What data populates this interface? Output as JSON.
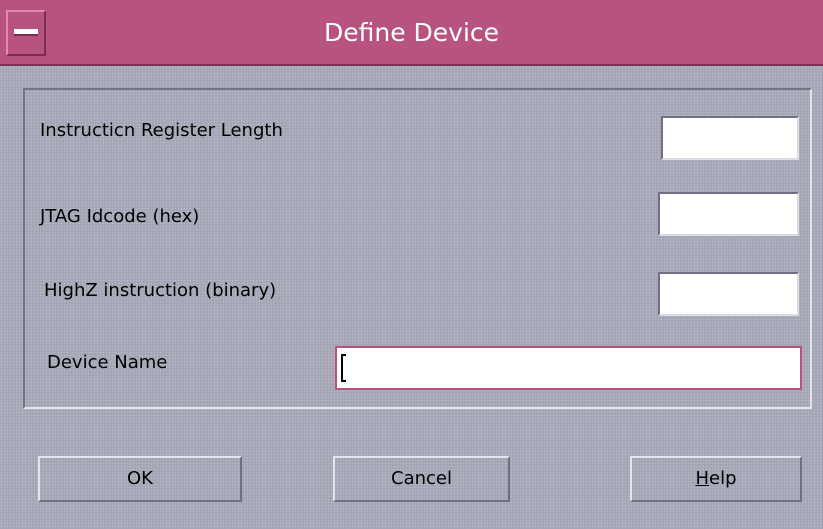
{
  "window": {
    "title": "Define Device",
    "sysmenu_icon": "window-menu-icon"
  },
  "form": {
    "ir_length": {
      "label": "Instructicn Register Length",
      "value": ""
    },
    "idcode": {
      "label": "JTAG Idcode (hex)",
      "value": ""
    },
    "highz": {
      "label": "HighZ instruction (binary)",
      "value": ""
    },
    "device_name": {
      "label": "Device Name",
      "value": ""
    }
  },
  "buttons": {
    "ok": "OK",
    "cancel": "Cancel",
    "help_mnemonic": "H",
    "help_rest": "elp"
  },
  "colors": {
    "titlebar": "#b8527e",
    "background": "#a9aab9",
    "focus_border": "#b8527e"
  }
}
